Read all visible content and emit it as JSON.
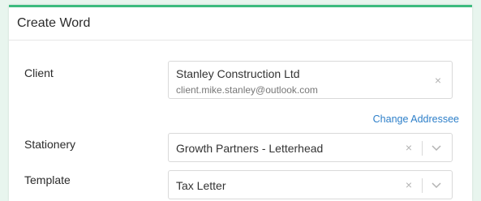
{
  "panel": {
    "title": "Create Word"
  },
  "client": {
    "label": "Client",
    "name": "Stanley Construction Ltd",
    "email": "client.mike.stanley@outlook.com",
    "clear": "×"
  },
  "change_addressee": "Change Addressee",
  "stationery": {
    "label": "Stationery",
    "value": "Growth Partners - Letterhead",
    "clear": "×"
  },
  "template": {
    "label": "Template",
    "value": "Tax Letter",
    "clear": "×"
  },
  "colors": {
    "accent": "#3dbb7f",
    "link": "#2d7fc9",
    "background": "#e8f5ee"
  },
  "icons": {
    "clear": "close-icon",
    "dropdown": "chevron-down-icon"
  }
}
